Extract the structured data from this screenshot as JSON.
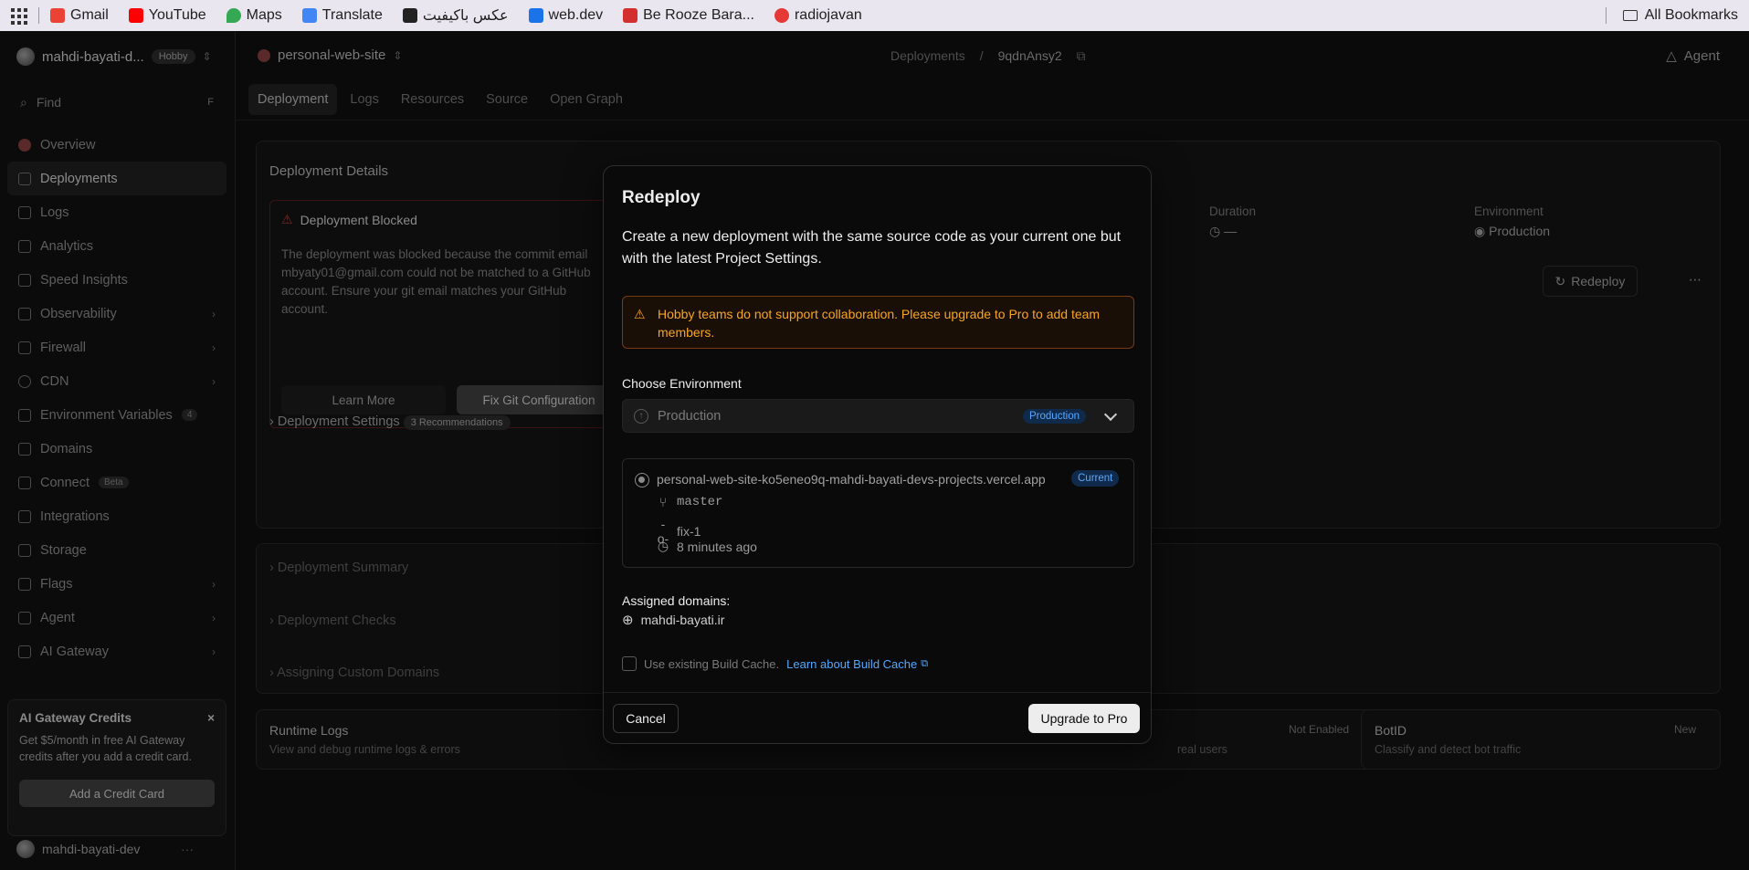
{
  "bookmarks": {
    "items": [
      {
        "label": "Gmail",
        "color": "#ea4335"
      },
      {
        "label": "YouTube",
        "color": "#ff0000"
      },
      {
        "label": "Maps",
        "color": "#34a853"
      },
      {
        "label": "Translate",
        "color": "#4285f4"
      },
      {
        "label": "عکس باکیفیت",
        "color": "#222222"
      },
      {
        "label": "web.dev",
        "color": "#1a73e8"
      },
      {
        "label": "Be Rooze Bara...",
        "color": "#d32f2f"
      },
      {
        "label": "radiojavan",
        "color": "#e53935"
      }
    ],
    "all_label": "All Bookmarks"
  },
  "sidebar": {
    "team_name": "mahdi-bayati-d...",
    "plan": "Hobby",
    "find_placeholder": "Find",
    "find_key": "F",
    "items": [
      {
        "label": "Overview"
      },
      {
        "label": "Deployments"
      },
      {
        "label": "Logs"
      },
      {
        "label": "Analytics"
      },
      {
        "label": "Speed Insights"
      },
      {
        "label": "Observability"
      },
      {
        "label": "Firewall"
      },
      {
        "label": "CDN"
      },
      {
        "label": "Environment Variables",
        "count": "4"
      },
      {
        "label": "Domains"
      },
      {
        "label": "Connect",
        "tag": "Beta"
      },
      {
        "label": "Integrations"
      },
      {
        "label": "Storage"
      },
      {
        "label": "Flags"
      },
      {
        "label": "Agent"
      },
      {
        "label": "AI Gateway"
      }
    ],
    "credits": {
      "title": "AI Gateway Credits",
      "text": "Get $5/month in free AI Gateway credits after you add a credit card.",
      "button": "Add a Credit Card"
    },
    "user": "mahdi-bayati-dev"
  },
  "header": {
    "project": "personal-web-site",
    "breadcrumb_root": "Deployments",
    "breadcrumb_id": "9qdnAnsy2",
    "agent": "Agent"
  },
  "tabs": [
    "Deployment",
    "Logs",
    "Resources",
    "Source",
    "Open Graph"
  ],
  "details": {
    "title": "Deployment Details",
    "redeploy": "Redeploy",
    "blocked_title": "Deployment Blocked",
    "blocked_text": "The deployment was blocked because the commit email mbyaty01@gmail.com could not be matched to a GitHub account. Ensure your git email matches your GitHub account.",
    "learn_more": "Learn More",
    "fix_git": "Fix Git Configuration",
    "duration_label": "Duration",
    "duration_value": "—",
    "environment_label": "Environment",
    "environment_value": "Production",
    "settings": "Deployment Settings",
    "recommendations": "3 Recommendations",
    "summary": "Deployment Summary",
    "checks": "Deployment Checks",
    "custom_domains": "Assigning Custom Domains"
  },
  "bottom_cards": {
    "runtime_title": "Runtime Logs",
    "runtime_text": "View and debug runtime logs & errors",
    "mid_badge": "Not Enabled",
    "mid_text": "real users",
    "botid_title": "BotID",
    "botid_badge": "New",
    "botid_text": "Classify and detect bot traffic"
  },
  "modal": {
    "title": "Redeploy",
    "description": "Create a new deployment with the same source code as your current one but with the latest Project Settings.",
    "warning": "Hobby teams do not support collaboration. Please upgrade to Pro to add team members.",
    "env_label": "Choose Environment",
    "env_value": "Production",
    "env_badge": "Production",
    "deployment_url": "personal-web-site-ko5eneo9q-mahdi-bayati-devs-projects.vercel.app",
    "current_badge": "Current",
    "branch": "master",
    "commit": "fix-1",
    "time_ago": "8 minutes ago",
    "assigned_label": "Assigned domains:",
    "domain": "mahdi-bayati.ir",
    "cache_label": "Use existing Build Cache.",
    "cache_link": "Learn about Build Cache",
    "cancel": "Cancel",
    "upgrade": "Upgrade to Pro"
  },
  "colors": {
    "accent_blue": "#52a8ff",
    "warning_orange": "#f5a524",
    "background": "#0a0a0a"
  }
}
